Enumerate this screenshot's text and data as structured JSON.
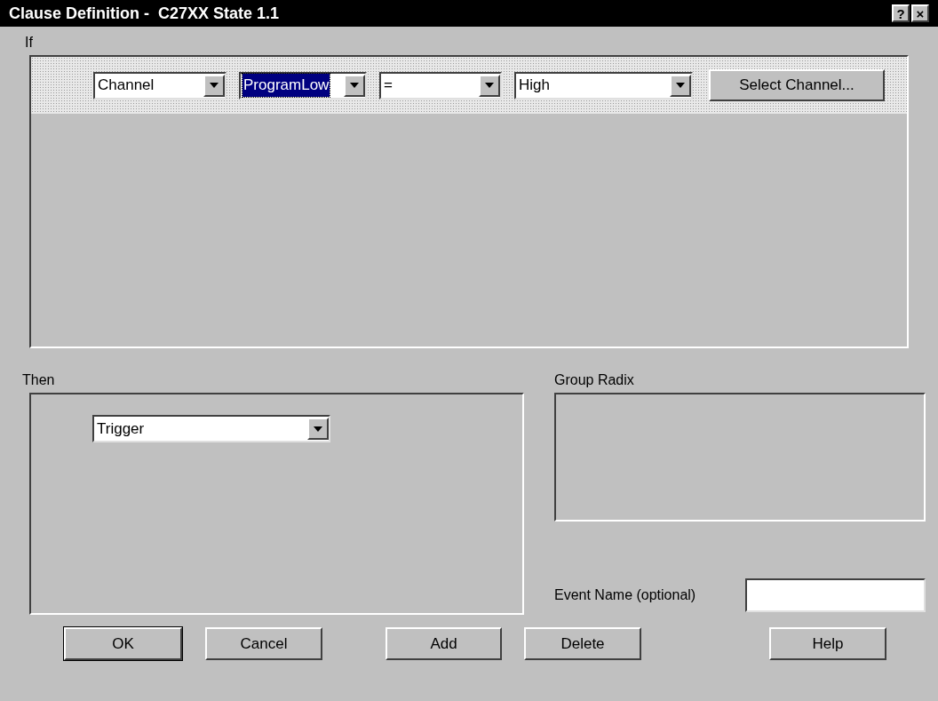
{
  "window": {
    "title": "Clause Definition -  C27XX State 1.1",
    "title_buttons": [
      "?",
      "×"
    ]
  },
  "if_section": {
    "label": "If",
    "conditions": [
      {
        "kind": "combo",
        "value": "Channel",
        "focused": false
      },
      {
        "kind": "combo",
        "value": "ProgramLow",
        "focused": true
      },
      {
        "kind": "combo",
        "value": "=",
        "focused": false
      },
      {
        "kind": "combo",
        "value": "High",
        "focused": false
      },
      {
        "kind": "button",
        "label": "Select Channel..."
      }
    ]
  },
  "then_section": {
    "label": "Then",
    "action": {
      "value": "Trigger",
      "focused": false
    }
  },
  "group_radix": {
    "label": "Group Radix"
  },
  "event_name": {
    "label": "Event Name (optional)"
  },
  "buttons": [
    {
      "label": "OK",
      "default": true
    },
    {
      "label": "Cancel",
      "default": false
    },
    {
      "label": "Add",
      "default": false
    },
    {
      "label": "Delete",
      "default": false
    },
    {
      "label": "Help",
      "default": false
    }
  ]
}
